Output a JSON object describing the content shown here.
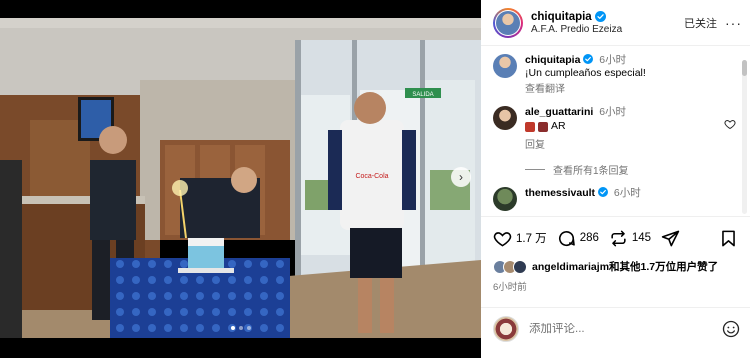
{
  "header": {
    "username": "chiquitapia",
    "location": "A.F.A. Predio Ezeiza",
    "follow_label": "已关注",
    "more_label": "···"
  },
  "caption": {
    "username": "chiquitapia",
    "time": "6小时",
    "text": "¡Un cumpleaños especial!",
    "translate_label": "查看翻译"
  },
  "comments": [
    {
      "username": "ale_guattarini",
      "time": "6小时",
      "text": "AR",
      "reply_label": "回复",
      "view_replies_label": "查看所有1条回复"
    },
    {
      "username": "themessivault",
      "time": "6小时"
    }
  ],
  "actions": {
    "likes_count": "1.7 万",
    "comments_count": "286",
    "shares_count": "145"
  },
  "likes_summary": {
    "username": "angeldimariajm",
    "text": "和其他1.7万位用户赞了"
  },
  "post_time": "6小时前",
  "add_comment": {
    "placeholder": "添加评论..."
  },
  "photo": {
    "sign_text": "SALIDA",
    "shirt_text": "Coca-Cola"
  },
  "carousel": {
    "total": 3,
    "active": 0
  },
  "icons": {
    "verified": "verified-badge-icon",
    "heart": "heart-icon",
    "comment": "comment-bubble-icon",
    "repost": "repost-icon",
    "share": "paper-plane-icon",
    "save": "bookmark-icon",
    "emoji": "smiley-icon",
    "next": "chevron-right-icon",
    "more": "more-dots-icon"
  },
  "colors": {
    "verified_blue": "#0095f6",
    "secondary_text": "#737373",
    "border": "#efefef"
  }
}
